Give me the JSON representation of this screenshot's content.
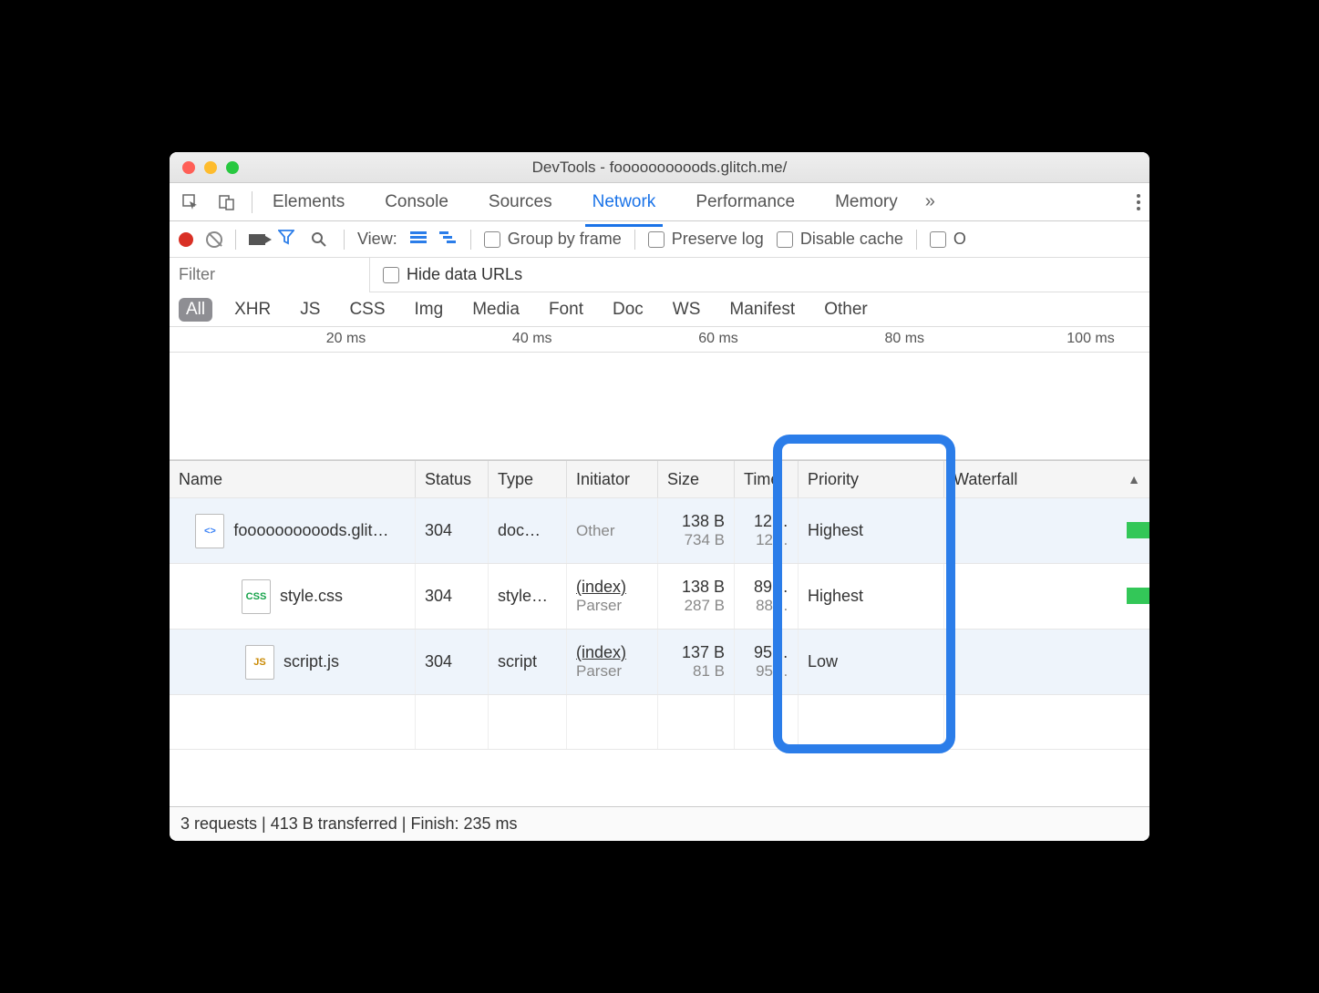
{
  "window": {
    "title": "DevTools - foooooooooods.glitch.me/"
  },
  "tabs": {
    "items": [
      "Elements",
      "Console",
      "Sources",
      "Network",
      "Performance",
      "Memory"
    ],
    "active": "Network",
    "more": "»"
  },
  "toolbar": {
    "view_label": "View:",
    "group_by_frame": "Group by frame",
    "preserve_log": "Preserve log",
    "disable_cache": "Disable cache",
    "offline_partial": "O"
  },
  "filter": {
    "placeholder": "Filter",
    "hide_data_urls": "Hide data URLs"
  },
  "types": [
    "All",
    "XHR",
    "JS",
    "CSS",
    "Img",
    "Media",
    "Font",
    "Doc",
    "WS",
    "Manifest",
    "Other"
  ],
  "types_active": "All",
  "ruler": [
    "20 ms",
    "40 ms",
    "60 ms",
    "80 ms",
    "100 ms"
  ],
  "columns": {
    "name": "Name",
    "status": "Status",
    "type": "Type",
    "initiator": "Initiator",
    "size": "Size",
    "time": "Time",
    "priority": "Priority",
    "waterfall": "Waterfall"
  },
  "rows": [
    {
      "icon": "doc",
      "name": "foooooooooods.glit…",
      "status": "304",
      "type": "doc…",
      "initiator": "Other",
      "initiator_sub": "",
      "size": "138 B",
      "size_sub": "734 B",
      "time": "12…",
      "time_sub": "12…",
      "priority": "Highest",
      "bar_left": "86%",
      "bar_width": "14%"
    },
    {
      "icon": "css",
      "name": "style.css",
      "status": "304",
      "type": "style…",
      "initiator": "(index)",
      "initiator_sub": "Parser",
      "size": "138 B",
      "size_sub": "287 B",
      "time": "89…",
      "time_sub": "88…",
      "priority": "Highest",
      "bar_left": "86%",
      "bar_width": "14%"
    },
    {
      "icon": "js",
      "name": "script.js",
      "status": "304",
      "type": "script",
      "initiator": "(index)",
      "initiator_sub": "Parser",
      "size": "137 B",
      "size_sub": "81 B",
      "time": "95…",
      "time_sub": "95…",
      "priority": "Low",
      "bar_left": "",
      "bar_width": ""
    }
  ],
  "status": "3 requests | 413 B transferred | Finish: 235 ms"
}
